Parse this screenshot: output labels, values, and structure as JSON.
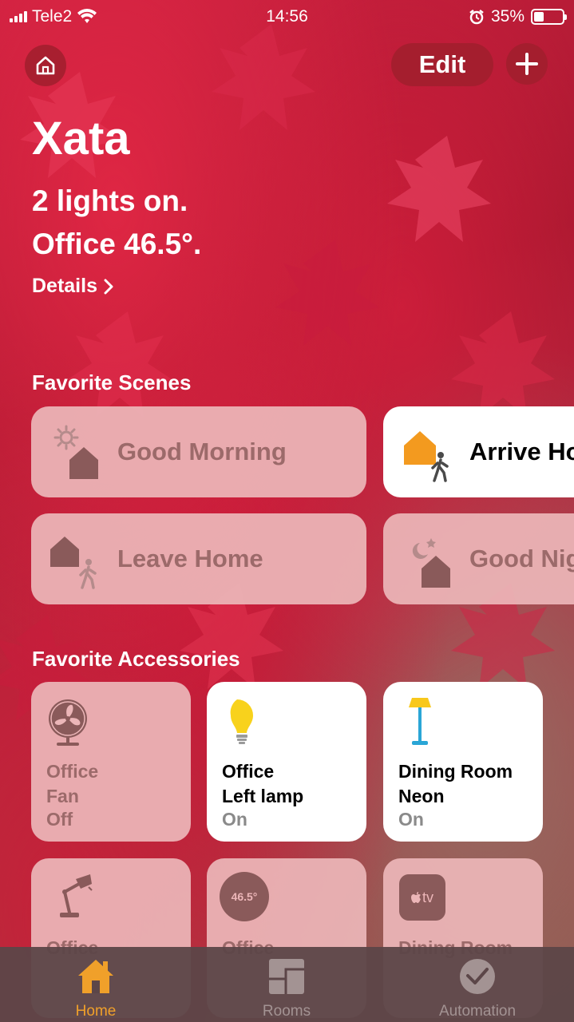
{
  "status_bar": {
    "carrier": "Tele2",
    "time": "14:56",
    "battery_percent": "35%",
    "battery_level": 0.35
  },
  "header": {
    "edit_label": "Edit",
    "home_name": "Xata",
    "status_line_1": "2 lights on.",
    "status_line_2": "Office 46.5°.",
    "details_label": "Details"
  },
  "favorite_scenes": {
    "title": "Favorite Scenes",
    "items": [
      {
        "label": "Good Morning",
        "icon": "good-morning-icon",
        "active": false
      },
      {
        "label": "Arrive Home",
        "icon": "arrive-home-icon",
        "active": true
      },
      {
        "label": "Leave Home",
        "icon": "leave-home-icon",
        "active": false
      },
      {
        "label": "Good Night",
        "icon": "good-night-icon",
        "active": false
      }
    ]
  },
  "favorite_accessories": {
    "title": "Favorite Accessories",
    "items": [
      {
        "name_line_1": "Office",
        "name_line_2": "Fan",
        "state": "Off",
        "icon": "fan-icon",
        "on": false
      },
      {
        "name_line_1": "Office",
        "name_line_2": "Left lamp",
        "state": "On",
        "icon": "light-bulb-icon",
        "on": true
      },
      {
        "name_line_1": "Dining Room",
        "name_line_2": "Neon",
        "state": "On",
        "icon": "floor-lamp-icon",
        "on": true
      },
      {
        "name_line_1": "Office",
        "name_line_2": "",
        "state": "",
        "icon": "desk-lamp-icon",
        "on": false
      },
      {
        "name_line_1": "Office",
        "name_line_2": "",
        "state": "",
        "icon": "thermostat-icon",
        "reading": "46.5°",
        "on": false
      },
      {
        "name_line_1": "Dining Room",
        "name_line_2": "",
        "state": "",
        "icon": "apple-tv-icon",
        "tv_label": "tv",
        "on": false
      }
    ]
  },
  "tab_bar": {
    "tabs": [
      {
        "label": "Home",
        "icon": "home-icon",
        "active": true
      },
      {
        "label": "Rooms",
        "icon": "rooms-icon",
        "active": false
      },
      {
        "label": "Automation",
        "icon": "automation-icon",
        "active": false
      }
    ]
  },
  "colors": {
    "accent_orange": "#f0a02a",
    "tile_off": "#ecb6b8",
    "tile_on": "#ffffff",
    "wallpaper_red": "#c8203f"
  }
}
